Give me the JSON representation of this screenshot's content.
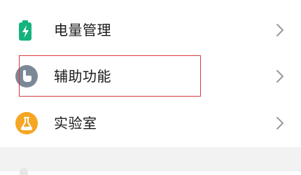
{
  "settings_list": {
    "items": [
      {
        "label": "电量管理",
        "icon": "battery-icon",
        "icon_color": "#14b37d"
      },
      {
        "label": "辅助功能",
        "icon": "accessibility-hand-icon",
        "icon_color": "#7b8897"
      },
      {
        "label": "实验室",
        "icon": "lab-flask-icon",
        "icon_color": "#f5a623"
      }
    ]
  },
  "colors": {
    "highlight_border": "#d93a3a",
    "chevron": "#9a9a9a",
    "section_divider": "#f2f2f2"
  }
}
